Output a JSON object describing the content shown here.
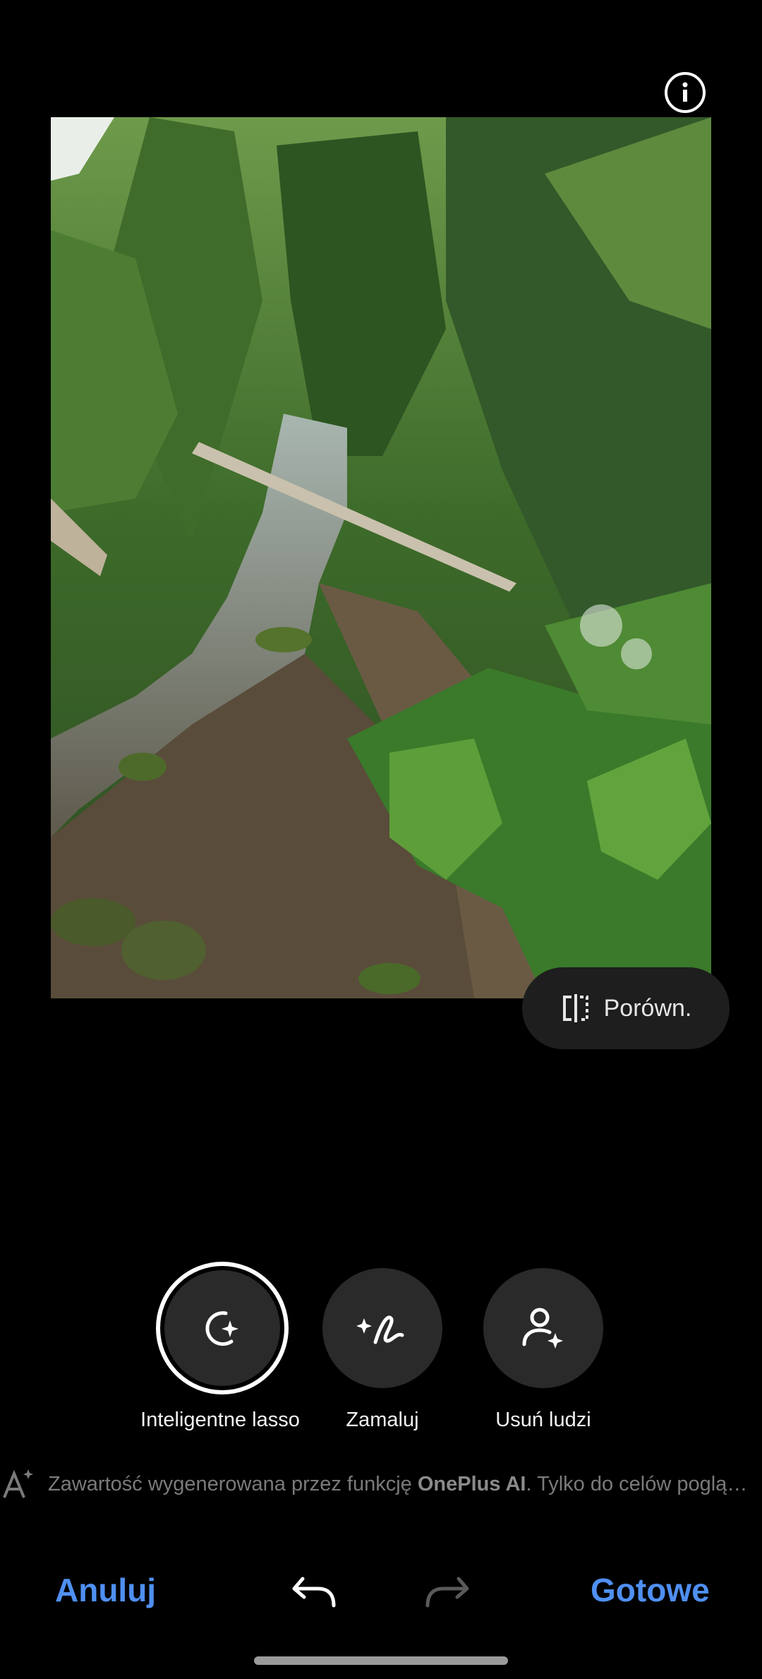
{
  "top": {
    "info_icon": "info-icon"
  },
  "photo": {
    "description_icon": "forest-stream-photo"
  },
  "compare": {
    "label": "Porówn.",
    "icon": "compare-split-icon"
  },
  "tools": [
    {
      "label": "Inteligentne lasso",
      "icon": "smart-lasso-icon",
      "selected": true
    },
    {
      "label": "Zamaluj",
      "icon": "brush-sparkle-icon",
      "selected": false
    },
    {
      "label": "Usuń ludzi",
      "icon": "remove-person-icon",
      "selected": false
    }
  ],
  "ai_note": {
    "prefix": "Zawartość wygenerowana przez funkcję ",
    "brand": "OnePlus AI",
    "suffix": ". Tylko do celów poglą…"
  },
  "bottom_bar": {
    "cancel_label": "Anuluj",
    "done_label": "Gotowe",
    "undo_icon": "undo-icon",
    "redo_icon": "redo-icon"
  },
  "colors": {
    "accent": "#4f8ff0",
    "background": "#000000"
  }
}
